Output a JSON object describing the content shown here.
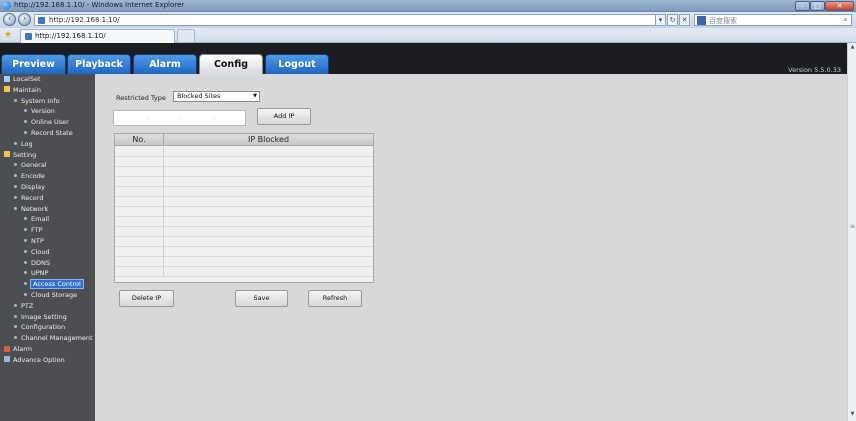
{
  "browser": {
    "window_title": "http://192.168.1.10/ - Windows Internet Explorer",
    "address_url": "http://192.168.1.10/",
    "search_placeholder": "百度搜索",
    "tab_title": "http://192.168.1.10/"
  },
  "nav": {
    "preview": "Preview",
    "playback": "Playback",
    "alarm": "Alarm",
    "config": "Config",
    "logout": "Logout"
  },
  "version": "Version 5.5.0.33",
  "sidebar": {
    "items": [
      {
        "label": "LocalSet",
        "level": 0,
        "icon": "localset-icon"
      },
      {
        "label": "Maintain",
        "level": 0,
        "icon": "maintain-icon"
      },
      {
        "label": "System Info",
        "level": 1
      },
      {
        "label": "Version",
        "level": 2
      },
      {
        "label": "Online User",
        "level": 2
      },
      {
        "label": "Record State",
        "level": 2
      },
      {
        "label": "Log",
        "level": 1
      },
      {
        "label": "Setting",
        "level": 0,
        "icon": "setting-icon"
      },
      {
        "label": "General",
        "level": 1
      },
      {
        "label": "Encode",
        "level": 1
      },
      {
        "label": "Display",
        "level": 1
      },
      {
        "label": "Record",
        "level": 1
      },
      {
        "label": "Network",
        "level": 1
      },
      {
        "label": "Email",
        "level": 2
      },
      {
        "label": "FTP",
        "level": 2
      },
      {
        "label": "NTP",
        "level": 2
      },
      {
        "label": "Cloud",
        "level": 2
      },
      {
        "label": "DDNS",
        "level": 2
      },
      {
        "label": "UPNP",
        "level": 2
      },
      {
        "label": "Access Control",
        "level": 2,
        "active": true
      },
      {
        "label": "Cloud Storage",
        "level": 2
      },
      {
        "label": "PTZ",
        "level": 1
      },
      {
        "label": "Image Setting",
        "level": 1
      },
      {
        "label": "Configuration",
        "level": 1
      },
      {
        "label": "Channel Management",
        "level": 1
      },
      {
        "label": "Alarm",
        "level": 0,
        "icon": "alarm-icon"
      },
      {
        "label": "Advance Option",
        "level": 0,
        "icon": "advance-icon"
      }
    ]
  },
  "access_control": {
    "restricted_type_label": "Restricted Type",
    "restricted_type_value": "Blocked Sites",
    "add_ip_label": "Add IP",
    "table_headers": {
      "no": "No.",
      "ip": "IP Blocked"
    },
    "delete_ip_label": "Delete IP",
    "save_label": "Save",
    "refresh_label": "Refresh"
  },
  "colors": {
    "header_bg": "#1b1d20",
    "tab_blue": "#2f7ad8",
    "sidebar_bg": "#4c4e52",
    "content_bg": "#d7d8da",
    "active_item": "#2f6fd0"
  }
}
